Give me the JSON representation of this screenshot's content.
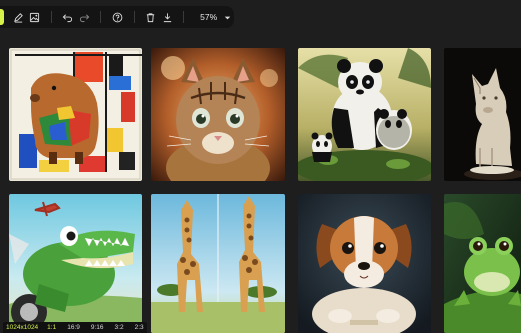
{
  "toolbar": {
    "zoom": "57%"
  },
  "footer": {
    "resolution": "1024x1024",
    "ratios": [
      "1:1",
      "16:9",
      "9:16",
      "3:2",
      "2:3"
    ]
  },
  "gallery": {
    "images": [
      {
        "subject": "capybara painting"
      },
      {
        "subject": "kitten portrait"
      },
      {
        "subject": "panda family"
      },
      {
        "subject": "ceramic dog statue"
      },
      {
        "subject": "crocodile cartoon"
      },
      {
        "subject": "giraffes pair"
      },
      {
        "subject": "puppy portrait"
      },
      {
        "subject": "frog on leaf"
      }
    ]
  }
}
